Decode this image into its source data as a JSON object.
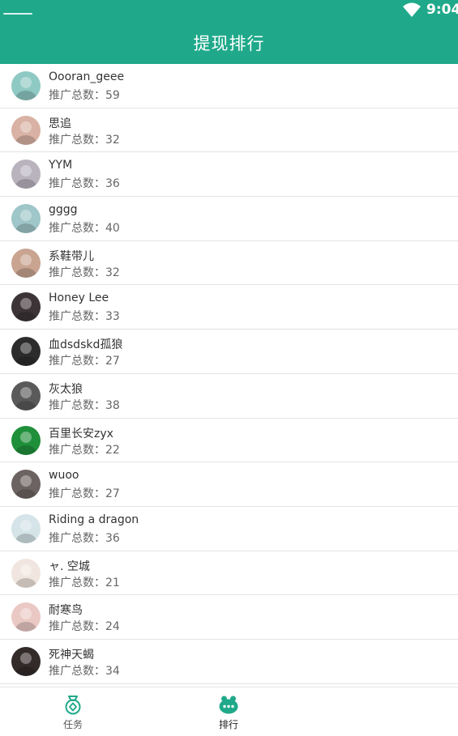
{
  "status_bar": {
    "time": "9:04"
  },
  "app_bar": {
    "title": "提现排行"
  },
  "count_prefix": "推广总数：",
  "ranking": [
    {
      "name": "Oooran_geee",
      "count": "59",
      "avatar_color": "#8fc9c4"
    },
    {
      "name": "思追",
      "count": "32",
      "avatar_color": "#d9b2a5"
    },
    {
      "name": "YYM",
      "count": "36",
      "avatar_color": "#b9b3bd"
    },
    {
      "name": "gggg",
      "count": "40",
      "avatar_color": "#9fc6c9"
    },
    {
      "name": "系鞋带儿",
      "count": "32",
      "avatar_color": "#c9a491"
    },
    {
      "name": "Honey Lee",
      "count": "33",
      "avatar_color": "#3c3436"
    },
    {
      "name": "血dsdskd孤狼",
      "count": "27",
      "avatar_color": "#2c2c2c"
    },
    {
      "name": "灰太狼",
      "count": "38",
      "avatar_color": "#5b5a5a"
    },
    {
      "name": "百里长安zyx",
      "count": "22",
      "avatar_color": "#1f8f3a"
    },
    {
      "name": "wuoo",
      "count": "27",
      "avatar_color": "#6d6262"
    },
    {
      "name": "Riding a dragon",
      "count": "36",
      "avatar_color": "#d5e4e8"
    },
    {
      "name": "ャ.  空城",
      "count": "21",
      "avatar_color": "#f1e6df"
    },
    {
      "name": "耐寒鸟",
      "count": "24",
      "avatar_color": "#eac9c5"
    },
    {
      "name": "  死神天蝎",
      "count": "34",
      "avatar_color": "#332a2a"
    }
  ],
  "tab_bar": {
    "tabs": [
      {
        "label": "任务",
        "icon": "money-bag-icon",
        "active": false
      },
      {
        "label": "排行",
        "icon": "chat-bubble-icon",
        "active": true
      }
    ],
    "accent_color": "#1fa98a"
  },
  "colors": {
    "primary": "#1fa98a",
    "divider": "#e3e3e3"
  }
}
